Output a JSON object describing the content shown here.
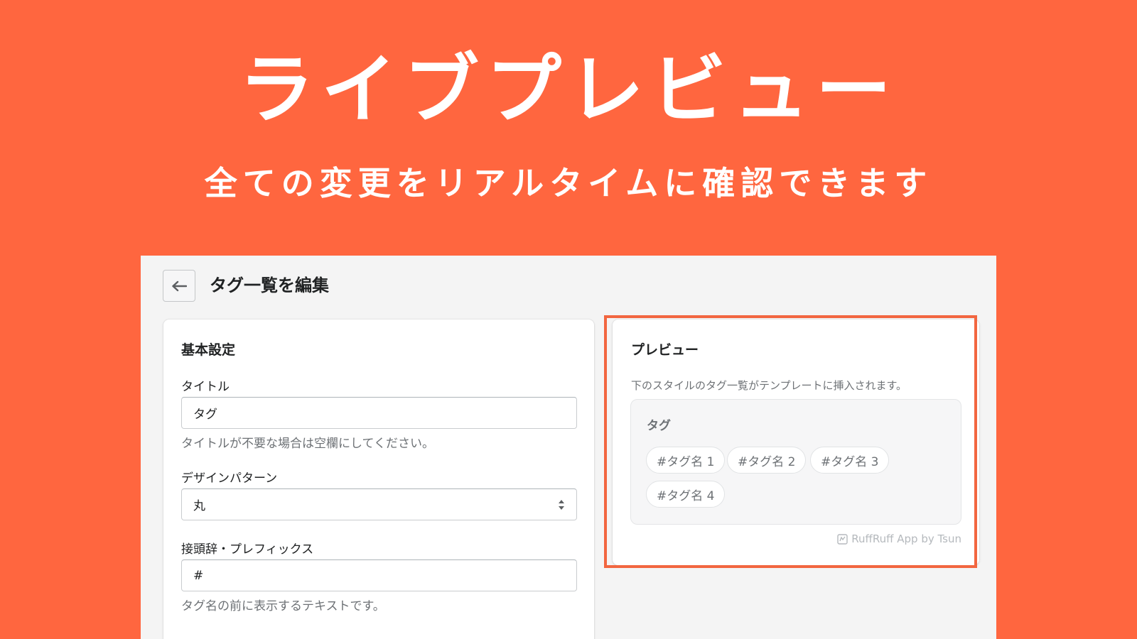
{
  "hero": {
    "title": "ライブプレビュー",
    "subtitle": "全ての変更をリアルタイムに確認できます"
  },
  "header": {
    "back_icon": "arrow-left-icon",
    "title": "タグ一覧を編集"
  },
  "settings": {
    "heading": "基本設定",
    "title_field": {
      "label": "タイトル",
      "value": "タグ",
      "help": "タイトルが不要な場合は空欄にしてください。"
    },
    "design_field": {
      "label": "デザインパターン",
      "value": "丸"
    },
    "prefix_field": {
      "label": "接頭辞・プレフィックス",
      "value": "#",
      "help": "タグ名の前に表示するテキストです。"
    }
  },
  "preview": {
    "heading": "プレビュー",
    "description": "下のスタイルのタグ一覧がテンプレートに挿入されます。",
    "box_title": "タグ",
    "tags": [
      "#タグ名 1",
      "#タグ名 2",
      "#タグ名 3",
      "#タグ名 4"
    ],
    "credit": "RuffRuff App by Tsun"
  },
  "colors": {
    "background": "#ff663f",
    "highlight": "#f26640"
  }
}
